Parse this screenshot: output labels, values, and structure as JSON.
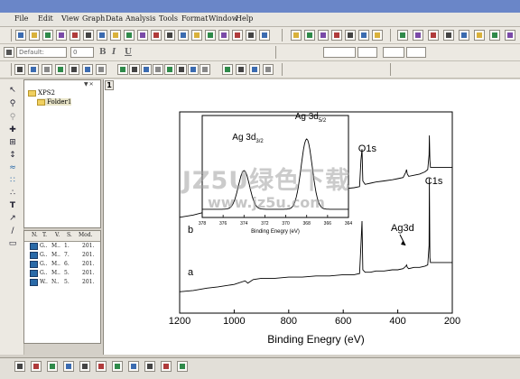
{
  "menu": {
    "items": [
      "File",
      "Edit",
      "View",
      "Graph",
      "Data",
      "Analysis",
      "Tools",
      "Format",
      "Window",
      "Help"
    ]
  },
  "format_toolbar": {
    "font_combo": "Default:",
    "size_combo": "0",
    "bold": "B",
    "italic": "I",
    "underline": "U"
  },
  "explorer": {
    "root": "XPS2",
    "child": "Folder1"
  },
  "file_list": {
    "columns": [
      "N.",
      "T.",
      "V.",
      "S.",
      "Mod."
    ],
    "rows": [
      {
        "n": "G..",
        "t": "M..",
        "v": "1.",
        "s": "",
        "m": "201."
      },
      {
        "n": "G..",
        "t": "M..",
        "v": "7.",
        "s": "",
        "m": "201."
      },
      {
        "n": "G..",
        "t": "M..",
        "v": "6.",
        "s": "",
        "m": "201."
      },
      {
        "n": "G..",
        "t": "M..",
        "v": "5.",
        "s": "",
        "m": "201."
      },
      {
        "n": "W..",
        "t": "N..",
        "v": "5.",
        "s": "",
        "m": "201."
      }
    ]
  },
  "workspace": {
    "page_tab": "1"
  },
  "chart_data": {
    "type": "line",
    "xlabel": "Binding Enegry (eV)",
    "xlim": [
      1200,
      200
    ],
    "xticks": [
      "1200",
      "1000",
      "800",
      "600",
      "400",
      "200"
    ],
    "series": [
      {
        "name": "b",
        "x": [
          1200,
          1150,
          1100,
          1060,
          1000,
          960,
          950,
          930,
          900,
          850,
          800,
          750,
          700,
          650,
          600,
          560,
          540,
          535,
          531,
          528,
          520,
          500,
          480,
          450,
          420,
          400,
          380,
          370,
          368,
          365,
          360,
          340,
          320,
          300,
          290,
          285,
          284,
          282,
          280,
          250,
          230,
          200
        ],
        "y": [
          20,
          22,
          25,
          27,
          30,
          34,
          30,
          36,
          38,
          39,
          40,
          42,
          43,
          44,
          45,
          46,
          47,
          70,
          80,
          52,
          49,
          50,
          51,
          52,
          53,
          54,
          55,
          60,
          62,
          58,
          56,
          57,
          58,
          60,
          62,
          75,
          92,
          70,
          64,
          64,
          64,
          64
        ]
      },
      {
        "name": "a",
        "x": [
          1200,
          1150,
          1100,
          1060,
          1000,
          960,
          950,
          930,
          900,
          850,
          800,
          750,
          700,
          650,
          600,
          560,
          540,
          535,
          531,
          528,
          520,
          500,
          480,
          450,
          420,
          400,
          380,
          370,
          368,
          365,
          360,
          340,
          320,
          300,
          290,
          285,
          284,
          282,
          280,
          250,
          230,
          200
        ],
        "y": [
          2,
          3,
          5,
          6,
          8,
          11,
          9,
          12,
          13,
          13,
          14,
          14,
          15,
          15,
          16,
          16,
          17,
          40,
          60,
          20,
          18,
          18,
          19,
          19,
          20,
          20,
          21,
          23,
          24,
          22,
          21,
          22,
          22,
          23,
          24,
          40,
          95,
          30,
          26,
          26,
          26,
          26
        ]
      }
    ],
    "annotations": [
      "O1s",
      "C1s",
      "Ag3d",
      "b",
      "a"
    ],
    "inset": {
      "xlabel": "Binding Enegry (eV)",
      "xlim": [
        378,
        364
      ],
      "xticks": [
        "378",
        "376",
        "374",
        "372",
        "370",
        "368",
        "366",
        "364"
      ],
      "peaks": [
        {
          "label_main": "Ag 3d",
          "label_sub": "3/2",
          "center": 374.0,
          "height": 0.55
        },
        {
          "label_main": "Ag 3d",
          "label_sub": "5/2",
          "center": 368.0,
          "height": 1.0
        }
      ]
    }
  }
}
